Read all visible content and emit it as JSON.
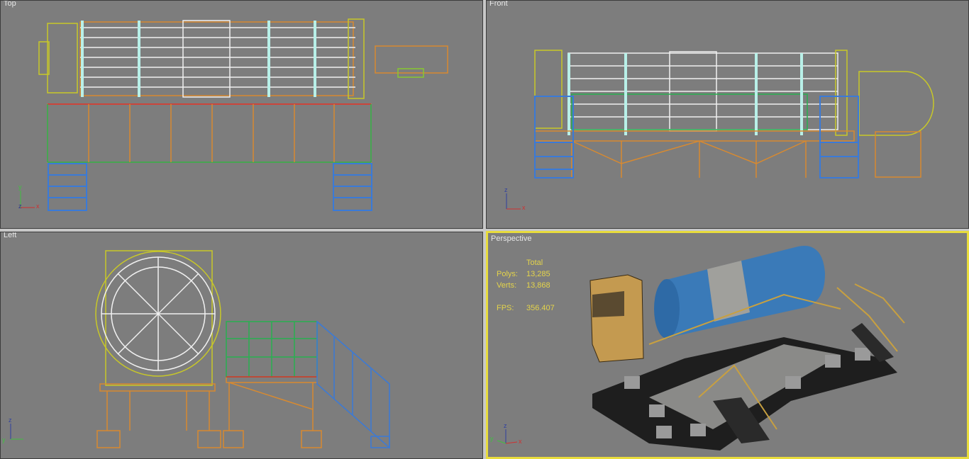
{
  "viewports": [
    {
      "label": "Top",
      "axes": [
        "y",
        "z",
        "x"
      ]
    },
    {
      "label": "Front",
      "axes": [
        "z",
        "y",
        "x"
      ]
    },
    {
      "label": "Left",
      "axes": [
        "z",
        "y",
        "x"
      ]
    },
    {
      "label": "Perspective",
      "axes": [
        "z",
        "y",
        "x"
      ]
    }
  ],
  "stats": {
    "header": "Total",
    "polys_label": "Polys:",
    "polys_value": "13,285",
    "verts_label": "Verts:",
    "verts_value": "13,868",
    "fps_label": "FPS:",
    "fps_value": "356.407"
  },
  "colors": {
    "viewport_bg": "#7d7d7d",
    "active_border": "#e8dc3c",
    "stats_text": "#e4d44a",
    "wire_orange": "#d88a30",
    "wire_blue": "#3a7ad8",
    "wire_green": "#28b050",
    "wire_white": "#f0f0f0",
    "wire_yellow": "#c8c828"
  }
}
